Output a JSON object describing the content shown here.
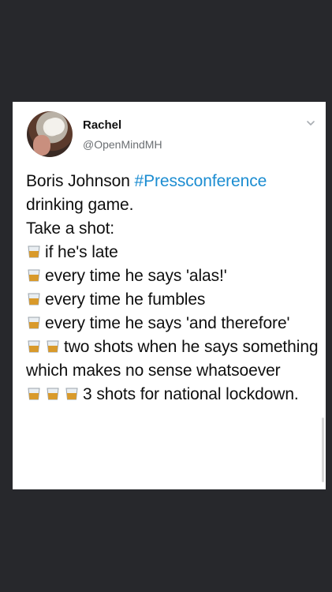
{
  "tweet": {
    "author_name": "Rachel",
    "author_handle": "@OpenMindMH",
    "line1_text": "Boris Johnson ",
    "line1_hashtag": "#Pressconference",
    "line2": "drinking game.",
    "line3": "Take a shot:",
    "item1": "if he's late",
    "item2": "every time he says 'alas!'",
    "item3": "every time he fumbles",
    "item4": "every time he says 'and therefore'",
    "item5": "two shots when he says something which makes no sense whatsoever",
    "item6": "3 shots for national lockdown."
  },
  "icons": {
    "shot_glass": "tumbler-glass-icon",
    "menu": "chevron-down-icon"
  },
  "colors": {
    "background": "#27282c",
    "card": "#ffffff",
    "hashtag": "#1c8dd1",
    "handle": "#6b6f73"
  }
}
